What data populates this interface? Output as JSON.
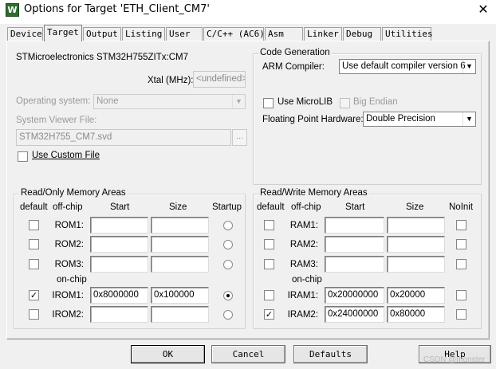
{
  "window": {
    "app_icon": "W",
    "title": "Options for Target 'ETH_Client_CM7'",
    "close": "✕"
  },
  "tabs": [
    "Device",
    "Target",
    "Output",
    "Listing",
    "User",
    "C/C++ (AC6)",
    "Asm",
    "Linker",
    "Debug",
    "Utilities"
  ],
  "active_tab": "Target",
  "device": {
    "name": "STMicroelectronics STM32H755ZITx:CM7",
    "xtal_label": "Xtal (MHz):",
    "xtal_value": "<undefined>",
    "os_label": "Operating system:",
    "os_value": "None",
    "svd_label": "System Viewer File:",
    "svd_value": "STM32H755_CM7.svd",
    "browse": "...",
    "custom_file_label": "Use Custom File",
    "custom_file_checked": false
  },
  "code_generation": {
    "title": "Code Generation",
    "compiler_label": "ARM Compiler:",
    "compiler_value": "Use default compiler version 6",
    "microlib_label": "Use MicroLIB",
    "microlib_checked": false,
    "big_endian_label": "Big Endian",
    "big_endian_checked": false,
    "fpu_label": "Floating Point Hardware:",
    "fpu_value": "Double Precision"
  },
  "ro_memory": {
    "title": "Read/Only Memory Areas",
    "headers": {
      "default": "default",
      "offchip": "off-chip",
      "start": "Start",
      "size": "Size",
      "startup": "Startup"
    },
    "onchip_label": "on-chip",
    "rows": [
      {
        "name": "ROM1:",
        "start": "",
        "size": "",
        "default": false,
        "startup": false
      },
      {
        "name": "ROM2:",
        "start": "",
        "size": "",
        "default": false,
        "startup": false
      },
      {
        "name": "ROM3:",
        "start": "",
        "size": "",
        "default": false,
        "startup": false
      },
      {
        "name": "IROM1:",
        "start": "0x8000000",
        "size": "0x100000",
        "default": true,
        "startup": true
      },
      {
        "name": "IROM2:",
        "start": "",
        "size": "",
        "default": false,
        "startup": false
      }
    ]
  },
  "rw_memory": {
    "title": "Read/Write Memory Areas",
    "headers": {
      "default": "default",
      "offchip": "off-chip",
      "start": "Start",
      "size": "Size",
      "noinit": "NoInit"
    },
    "onchip_label": "on-chip",
    "rows": [
      {
        "name": "RAM1:",
        "start": "",
        "size": "",
        "default": false,
        "noinit": false
      },
      {
        "name": "RAM2:",
        "start": "",
        "size": "",
        "default": false,
        "noinit": false
      },
      {
        "name": "RAM3:",
        "start": "",
        "size": "",
        "default": false,
        "noinit": false
      },
      {
        "name": "IRAM1:",
        "start": "0x20000000",
        "size": "0x20000",
        "default": false,
        "noinit": false
      },
      {
        "name": "IRAM2:",
        "start": "0x24000000",
        "size": "0x80000",
        "default": true,
        "noinit": false
      }
    ]
  },
  "buttons": {
    "ok": "OK",
    "cancel": "Cancel",
    "defaults": "Defaults",
    "help": "Help"
  },
  "watermark": "CSDN @monster"
}
